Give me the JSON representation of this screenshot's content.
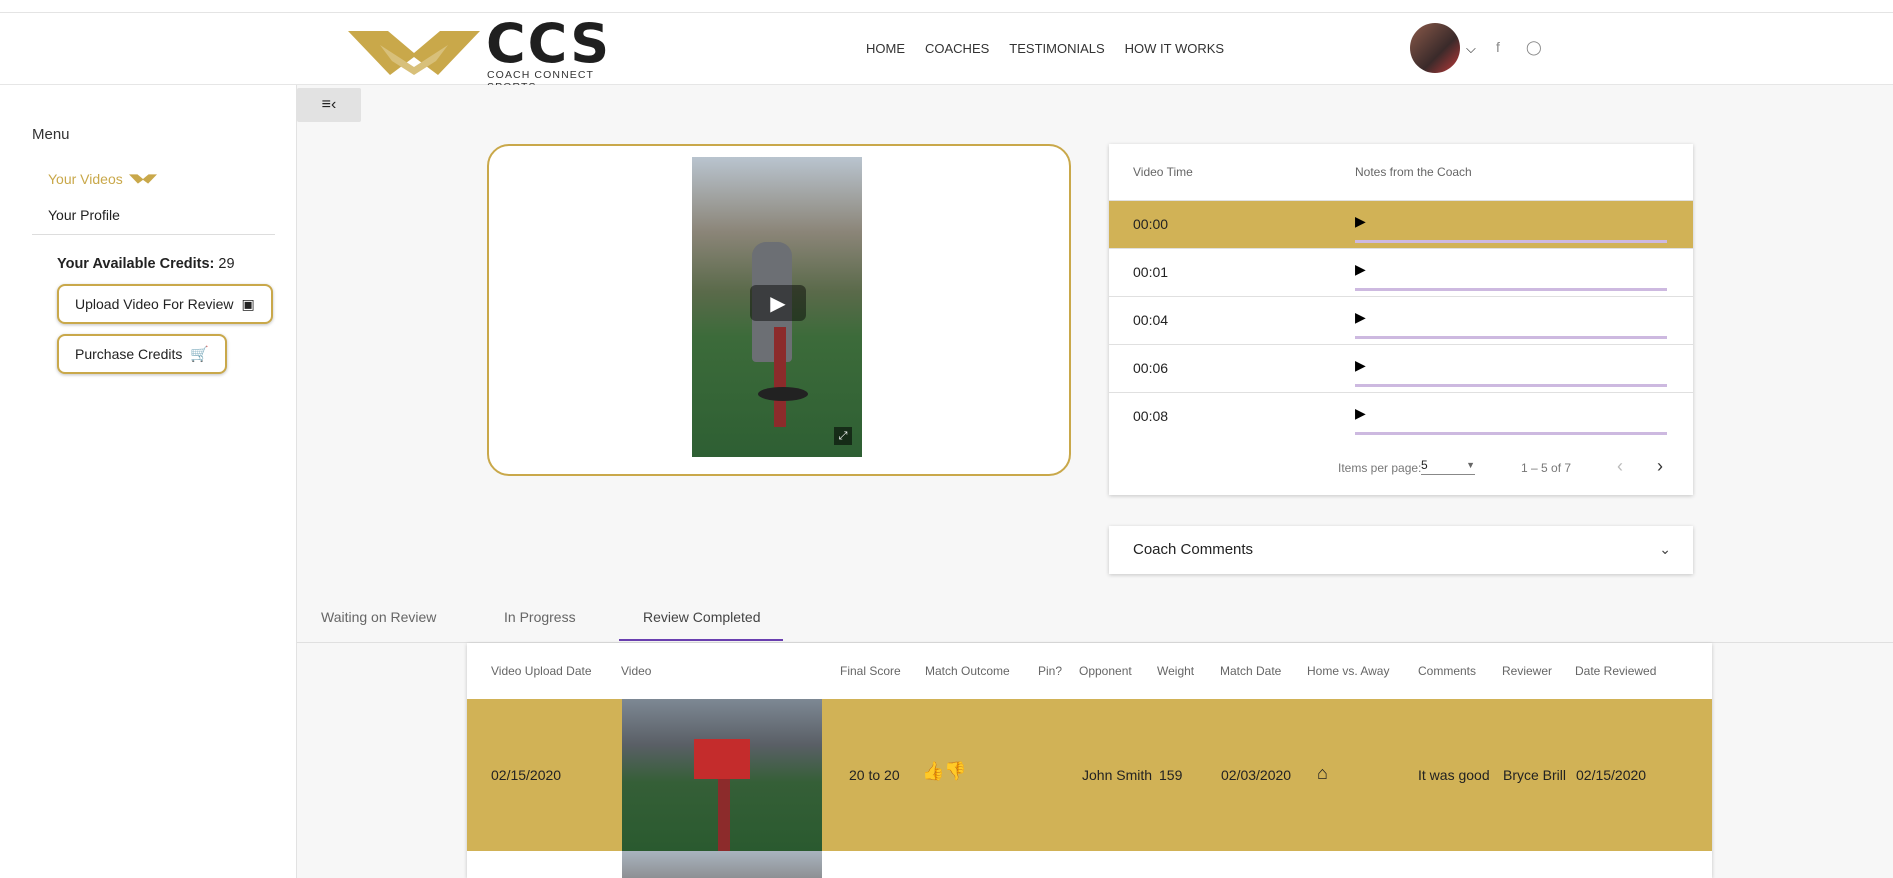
{
  "brand": {
    "name": "CCS",
    "tagline": "COACH CONNECT SPORTS",
    "accent": "#c9a84a",
    "row_highlight": "#d1b256"
  },
  "nav": {
    "items": [
      "HOME",
      "COACHES",
      "TESTIMONIALS",
      "HOW IT WORKS"
    ]
  },
  "sidebar": {
    "menu_title": "Menu",
    "items": [
      {
        "label": "Your Videos",
        "active": true
      },
      {
        "label": "Your Profile",
        "active": false
      }
    ],
    "credits_label": "Your Available Credits:",
    "credits_value": "29",
    "upload_label": "Upload Video For Review",
    "purchase_label": "Purchase Credits"
  },
  "notes_table": {
    "headers": [
      "Video Time",
      "Notes from the Coach"
    ],
    "rows": [
      {
        "time": "00:00",
        "selected": true
      },
      {
        "time": "00:01",
        "selected": false
      },
      {
        "time": "00:04",
        "selected": false
      },
      {
        "time": "00:06",
        "selected": false
      },
      {
        "time": "00:08",
        "selected": false
      }
    ],
    "items_per_page_label": "Items per page:",
    "items_per_page": "5",
    "range": "1 – 5 of 7"
  },
  "coach_comments": {
    "label": "Coach Comments"
  },
  "tabs": [
    "Waiting on Review",
    "In Progress",
    "Review Completed"
  ],
  "active_tab": "Review Completed",
  "reviews_table": {
    "headers": [
      "Video Upload Date",
      "Video",
      "Final Score",
      "Match Outcome",
      "Pin?",
      "Opponent",
      "Weight",
      "Match Date",
      "Home vs. Away",
      "Comments",
      "Reviewer",
      "Date Reviewed"
    ],
    "rows": [
      {
        "upload_date": "02/15/2020",
        "final_score": "20 to 20",
        "match_outcome": "thumbs-up-down-icon",
        "opponent": "John Smith",
        "weight": "159",
        "match_date": "02/03/2020",
        "home_away": "home-icon",
        "comments": "It was good",
        "reviewer": "Bryce Brill",
        "date_reviewed": "02/15/2020"
      }
    ]
  }
}
